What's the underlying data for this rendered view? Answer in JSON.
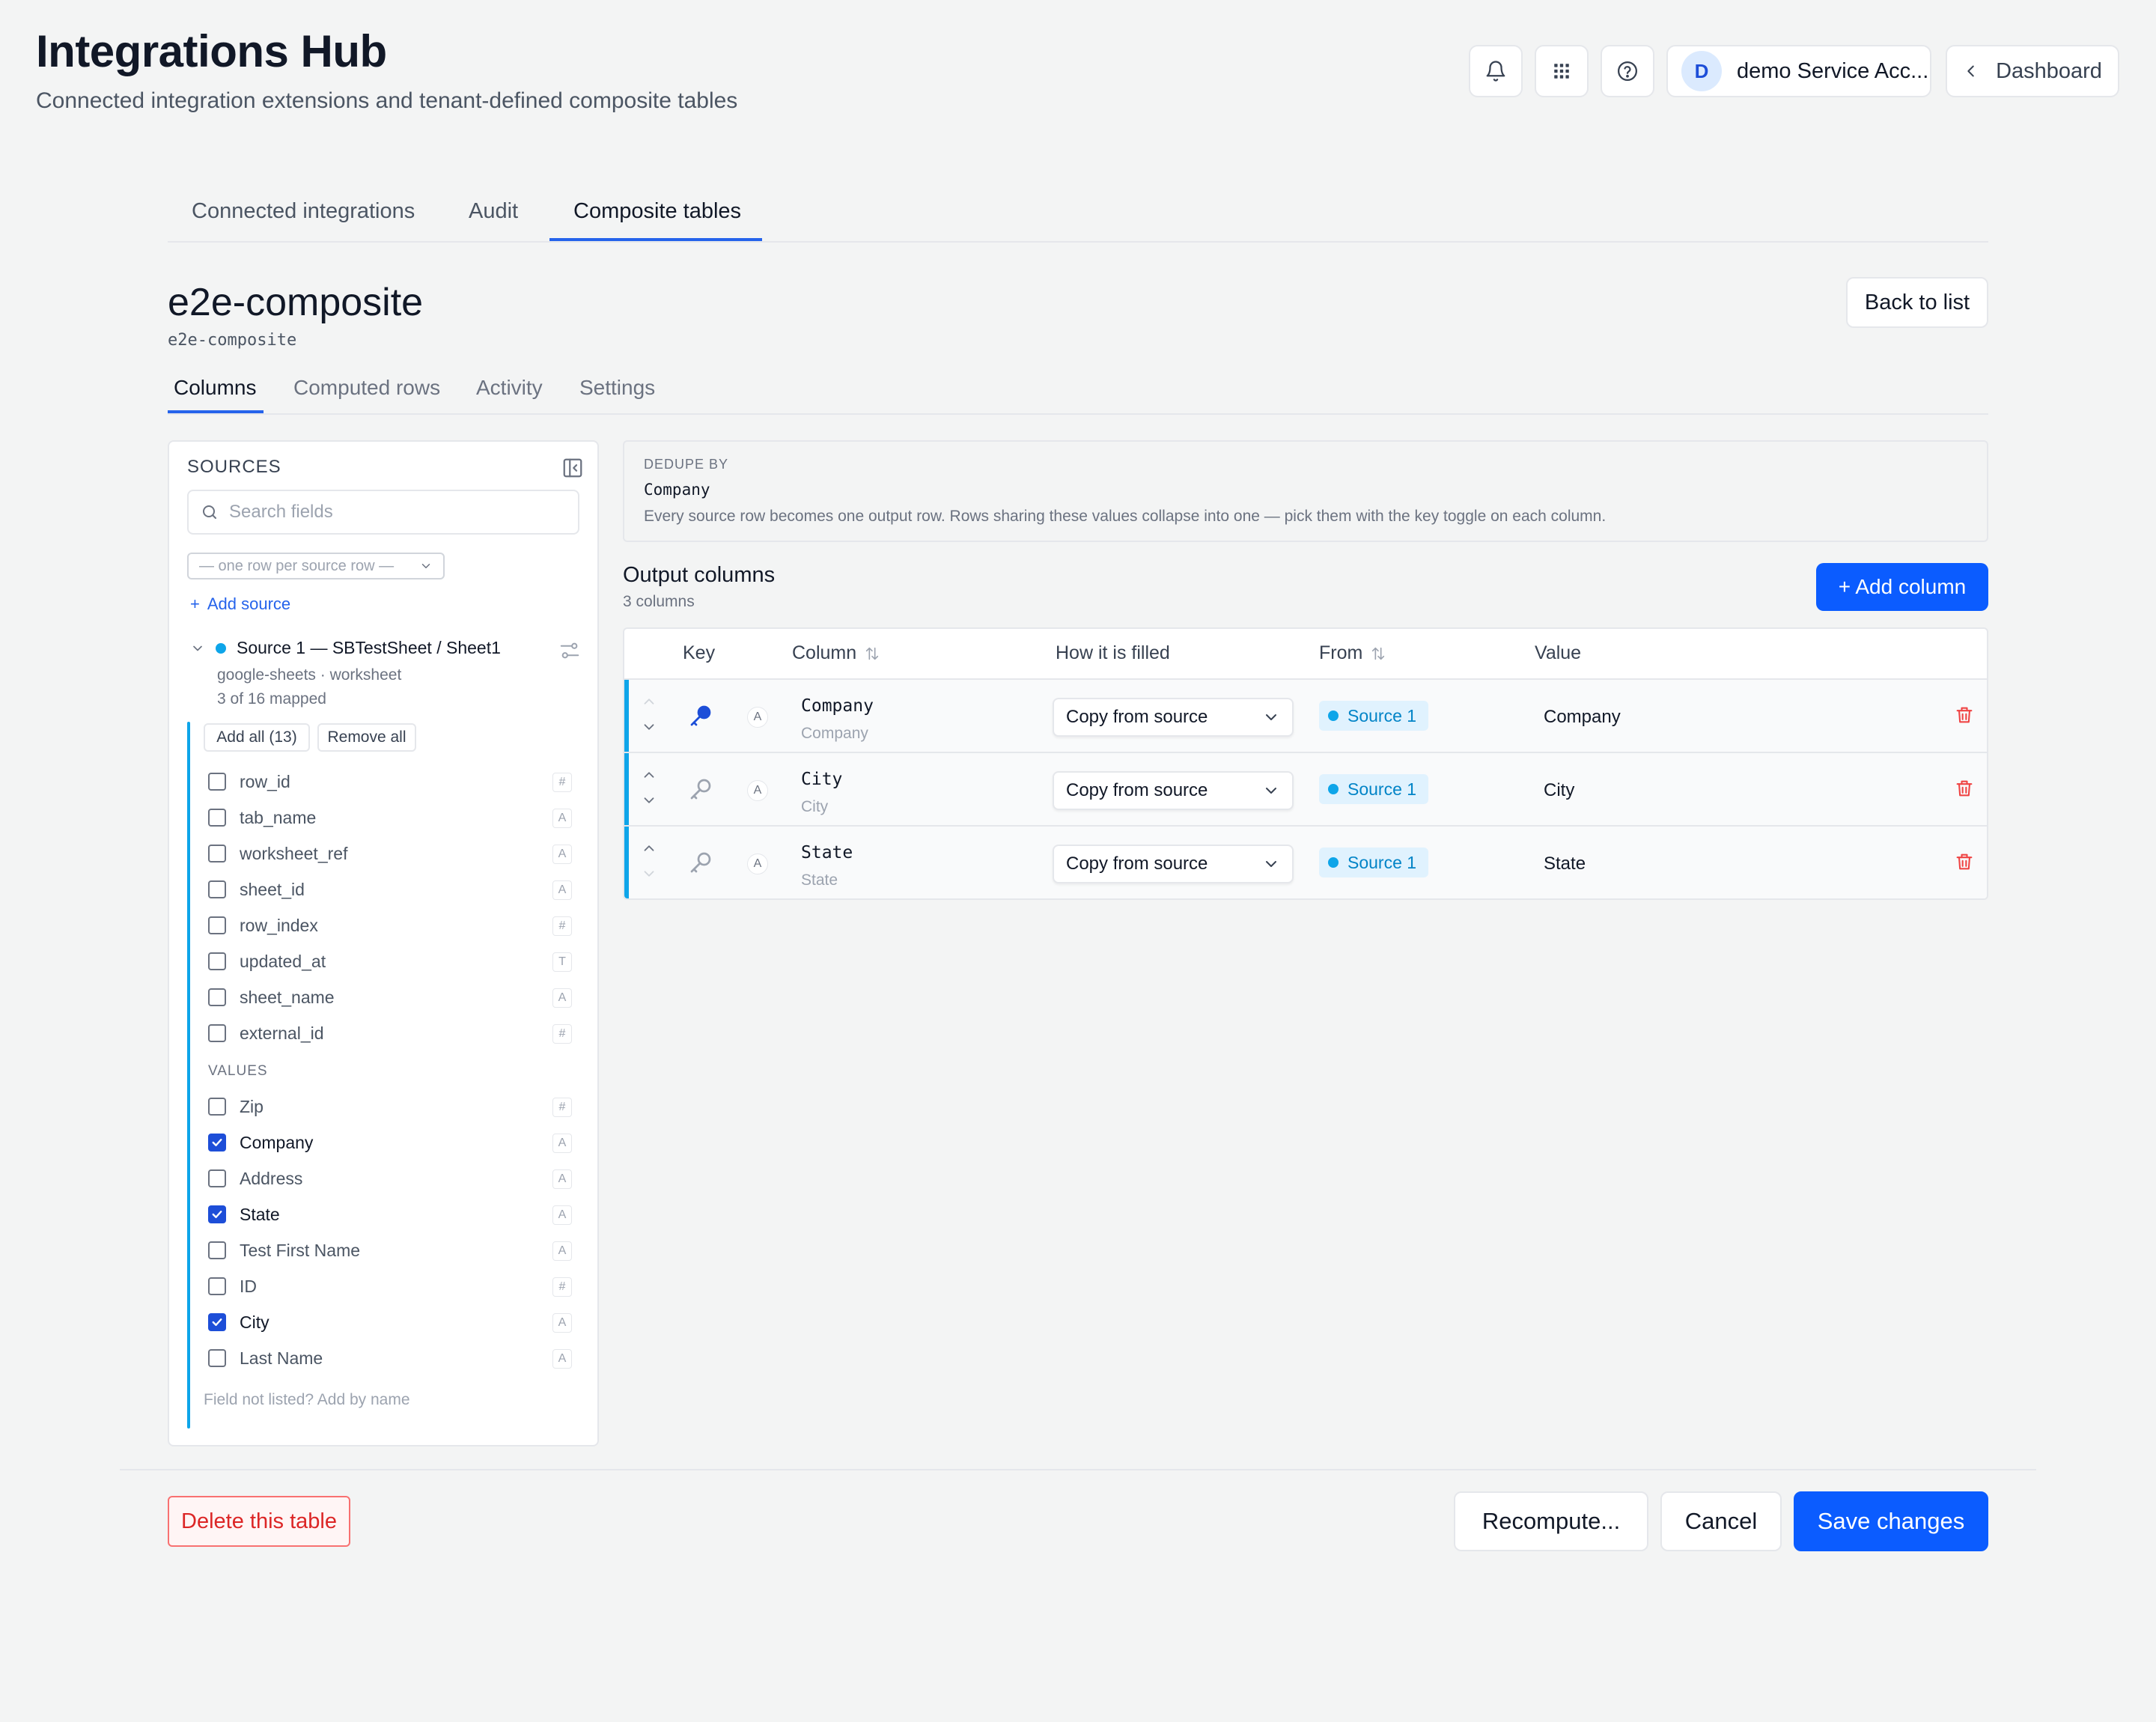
{
  "header": {
    "title": "Integrations Hub",
    "subtitle": "Connected integration extensions and tenant-defined composite tables",
    "account_initial": "D",
    "account_name": "demo Service Acc...",
    "dashboard_label": "Dashboard",
    "icons": [
      "bell-icon",
      "apps-grid-icon",
      "help-icon"
    ]
  },
  "top_tabs": [
    {
      "label": "Connected integrations",
      "active": false
    },
    {
      "label": "Audit",
      "active": false
    },
    {
      "label": "Composite tables",
      "active": true
    }
  ],
  "table": {
    "title": "e2e-composite",
    "slug": "e2e-composite",
    "back_label": "Back to list"
  },
  "sub_tabs": [
    {
      "label": "Columns",
      "active": true
    },
    {
      "label": "Computed rows",
      "active": false
    },
    {
      "label": "Activity",
      "active": false
    },
    {
      "label": "Settings",
      "active": false
    }
  ],
  "sources": {
    "heading": "SOURCES",
    "search_placeholder": "Search fields",
    "mode_value": "— one row per source row —",
    "add_source_label": "Add source",
    "source": {
      "name": "Source 1 — SBTestSheet / Sheet1",
      "meta": "google-sheets · worksheet",
      "mapped": "3 of 16 mapped",
      "color": "#0ea5e9"
    },
    "add_all_label": "Add all (13)",
    "remove_all_label": "Remove all",
    "system_fields": [
      {
        "name": "row_id",
        "type": "#",
        "checked": false
      },
      {
        "name": "tab_name",
        "type": "A",
        "checked": false
      },
      {
        "name": "worksheet_ref",
        "type": "A",
        "checked": false
      },
      {
        "name": "sheet_id",
        "type": "A",
        "checked": false
      },
      {
        "name": "row_index",
        "type": "#",
        "checked": false
      },
      {
        "name": "updated_at",
        "type": "T",
        "checked": false
      },
      {
        "name": "sheet_name",
        "type": "A",
        "checked": false
      },
      {
        "name": "external_id",
        "type": "#",
        "checked": false
      }
    ],
    "values_heading": "VALUES",
    "value_fields": [
      {
        "name": "Zip",
        "type": "#",
        "checked": false
      },
      {
        "name": "Company",
        "type": "A",
        "checked": true
      },
      {
        "name": "Address",
        "type": "A",
        "checked": false
      },
      {
        "name": "State",
        "type": "A",
        "checked": true
      },
      {
        "name": "Test First Name",
        "type": "A",
        "checked": false
      },
      {
        "name": "ID",
        "type": "#",
        "checked": false
      },
      {
        "name": "City",
        "type": "A",
        "checked": true
      },
      {
        "name": "Last Name",
        "type": "A",
        "checked": false
      }
    ],
    "not_listed_label": "Field not listed? Add by name"
  },
  "dedupe": {
    "label": "DEDUPE BY",
    "value": "Company",
    "help": "Every source row becomes one output row. Rows sharing these values collapse into one — pick them with the key toggle on each column."
  },
  "output": {
    "title": "Output columns",
    "count": "3 columns",
    "add_column_label": "+ Add column",
    "headers": {
      "key": "Key",
      "column": "Column",
      "how": "How it is filled",
      "from": "From",
      "value": "Value"
    },
    "rows": [
      {
        "name": "Company",
        "sub": "Company",
        "type": "A",
        "fill": "Copy from source",
        "source": "Source 1",
        "value": "Company",
        "is_key": true
      },
      {
        "name": "City",
        "sub": "City",
        "type": "A",
        "fill": "Copy from source",
        "source": "Source 1",
        "value": "City",
        "is_key": false
      },
      {
        "name": "State",
        "sub": "State",
        "type": "A",
        "fill": "Copy from source",
        "source": "Source 1",
        "value": "State",
        "is_key": false
      }
    ]
  },
  "footer": {
    "delete_label": "Delete this table",
    "recompute_label": "Recompute...",
    "cancel_label": "Cancel",
    "save_label": "Save changes"
  },
  "colors": {
    "accent": "#0b5cff",
    "source": "#0ea5e9",
    "danger": "#dc2626"
  }
}
